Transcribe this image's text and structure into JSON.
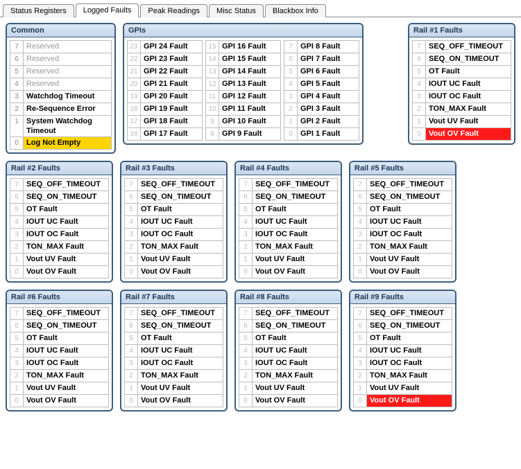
{
  "tabs": [
    {
      "label": "Status Registers",
      "active": false
    },
    {
      "label": "Logged Faults",
      "active": true
    },
    {
      "label": "Peak Readings",
      "active": false
    },
    {
      "label": "Misc Status",
      "active": false
    },
    {
      "label": "Blackbox Info",
      "active": false
    }
  ],
  "common": {
    "title": "Common",
    "rows": [
      {
        "idx": 7,
        "label": "Reserved",
        "state": "disabled"
      },
      {
        "idx": 6,
        "label": "Reserved",
        "state": "disabled"
      },
      {
        "idx": 5,
        "label": "Reserved",
        "state": "disabled"
      },
      {
        "idx": 4,
        "label": "Reserved",
        "state": "disabled"
      },
      {
        "idx": 3,
        "label": "Watchdog Timeout",
        "state": "normal"
      },
      {
        "idx": 2,
        "label": "Re-Sequence Error",
        "state": "normal"
      },
      {
        "idx": 1,
        "label": "System Watchdog Timeout",
        "state": "normal"
      },
      {
        "idx": 0,
        "label": "Log Not Empty",
        "state": "yellow"
      }
    ]
  },
  "gpi": {
    "title": "GPIs",
    "columns": [
      [
        {
          "idx": 23,
          "label": "GPI 24 Fault"
        },
        {
          "idx": 22,
          "label": "GPI 23 Fault"
        },
        {
          "idx": 21,
          "label": "GPI 22 Fault"
        },
        {
          "idx": 20,
          "label": "GPI 21 Fault"
        },
        {
          "idx": 19,
          "label": "GPI 20 Fault"
        },
        {
          "idx": 18,
          "label": "GPI 19 Fault"
        },
        {
          "idx": 17,
          "label": "GPI 18 Fault"
        },
        {
          "idx": 16,
          "label": "GPI 17 Fault"
        }
      ],
      [
        {
          "idx": 15,
          "label": "GPI 16 Fault"
        },
        {
          "idx": 14,
          "label": "GPI 15 Fault"
        },
        {
          "idx": 13,
          "label": "GPI 14 Fault"
        },
        {
          "idx": 12,
          "label": "GPI 13 Fault"
        },
        {
          "idx": 11,
          "label": "GPI 12 Fault"
        },
        {
          "idx": 10,
          "label": "GPI 11 Fault"
        },
        {
          "idx": 9,
          "label": "GPI 10 Fault"
        },
        {
          "idx": 8,
          "label": "GPI 9 Fault"
        }
      ],
      [
        {
          "idx": 7,
          "label": "GPI 8 Fault"
        },
        {
          "idx": 6,
          "label": "GPI 7 Fault"
        },
        {
          "idx": 5,
          "label": "GPI 6 Fault"
        },
        {
          "idx": 4,
          "label": "GPI 5 Fault"
        },
        {
          "idx": 3,
          "label": "GPI 4 Fault"
        },
        {
          "idx": 2,
          "label": "GPI 3 Fault"
        },
        {
          "idx": 1,
          "label": "GPI 2 Fault"
        },
        {
          "idx": 0,
          "label": "GPI 1 Fault"
        }
      ]
    ]
  },
  "rail_labels": [
    "SEQ_OFF_TIMEOUT",
    "SEQ_ON_TIMEOUT",
    "OT Fault",
    "IOUT UC Fault",
    "IOUT OC Fault",
    "TON_MAX Fault",
    "Vout UV Fault",
    "Vout OV Fault"
  ],
  "rails": [
    {
      "title": "Rail #1 Faults",
      "states": [
        "normal",
        "normal",
        "normal",
        "normal",
        "normal",
        "normal",
        "normal",
        "red"
      ]
    },
    {
      "title": "Rail #2 Faults",
      "states": [
        "normal",
        "normal",
        "normal",
        "normal",
        "normal",
        "normal",
        "normal",
        "normal"
      ]
    },
    {
      "title": "Rail #3 Faults",
      "states": [
        "normal",
        "normal",
        "normal",
        "normal",
        "normal",
        "normal",
        "normal",
        "normal"
      ]
    },
    {
      "title": "Rail #4 Faults",
      "states": [
        "normal",
        "normal",
        "normal",
        "normal",
        "normal",
        "normal",
        "normal",
        "normal"
      ]
    },
    {
      "title": "Rail #5 Faults",
      "states": [
        "normal",
        "normal",
        "normal",
        "normal",
        "normal",
        "normal",
        "normal",
        "normal"
      ]
    },
    {
      "title": "Rail #6 Faults",
      "states": [
        "normal",
        "normal",
        "normal",
        "normal",
        "normal",
        "normal",
        "normal",
        "normal"
      ]
    },
    {
      "title": "Rail #7 Faults",
      "states": [
        "normal",
        "normal",
        "normal",
        "normal",
        "normal",
        "normal",
        "normal",
        "normal"
      ]
    },
    {
      "title": "Rail #8 Faults",
      "states": [
        "normal",
        "normal",
        "normal",
        "normal",
        "normal",
        "normal",
        "normal",
        "normal"
      ]
    },
    {
      "title": "Rail #9 Faults",
      "states": [
        "normal",
        "normal",
        "normal",
        "normal",
        "normal",
        "normal",
        "normal",
        "red"
      ]
    }
  ]
}
